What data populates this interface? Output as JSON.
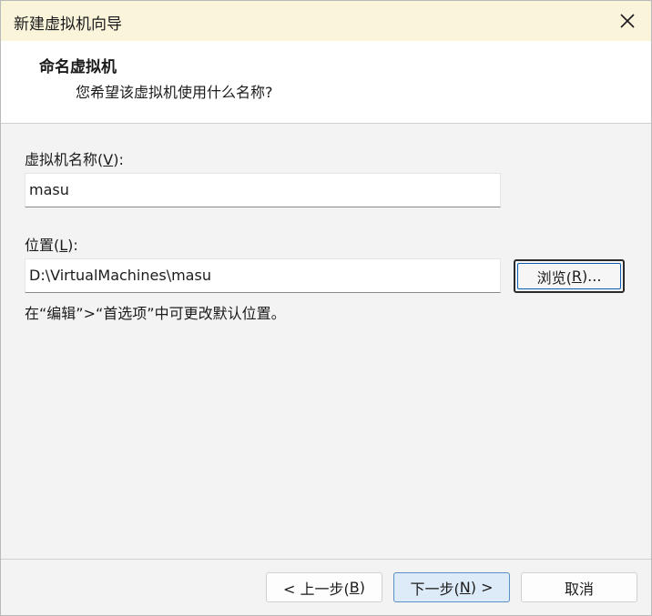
{
  "window": {
    "title": "新建虚拟机向导",
    "close_label": "关闭"
  },
  "header": {
    "title": "命名虚拟机",
    "subtitle": "您希望该虚拟机使用什么名称?"
  },
  "form": {
    "name_label_pre": "虚拟机名称(",
    "name_label_key": "V",
    "name_label_post": "):",
    "name_value": "masu",
    "location_label_pre": "位置(",
    "location_label_key": "L",
    "location_label_post": "):",
    "location_value": "D:\\VirtualMachines\\masu",
    "browse_pre": "浏览(",
    "browse_key": "R",
    "browse_post": ")...",
    "hint": "在“编辑”>“首选项”中可更改默认位置。"
  },
  "footer": {
    "back_pre": "< 上一步(",
    "back_key": "B",
    "back_post": ")",
    "next_pre": "下一步(",
    "next_key": "N",
    "next_post": ") >",
    "cancel": "取消"
  },
  "icons": {
    "close": "close-icon"
  }
}
